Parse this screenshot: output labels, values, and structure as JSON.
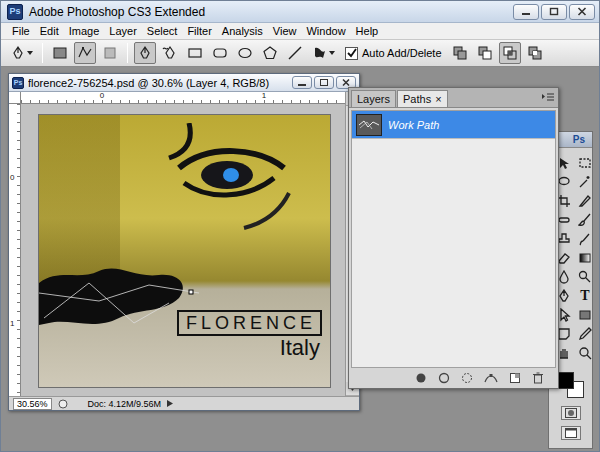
{
  "window": {
    "title": "Adobe Photoshop CS3 Extended",
    "app_icon": "Ps"
  },
  "menu": [
    "File",
    "Edit",
    "Image",
    "Layer",
    "Select",
    "Filter",
    "Analysis",
    "View",
    "Window",
    "Help"
  ],
  "options_bar": {
    "auto_add_delete": {
      "label": "Auto Add/Delete",
      "checked": true
    }
  },
  "document": {
    "title": "florence2-756254.psd @ 30.6% (Layer 4, RGB/8)",
    "ruler_top": [
      "0",
      "1"
    ],
    "ruler_left": [
      "0",
      "1"
    ],
    "canvas_texts": {
      "title": "FLORENCE",
      "subtitle": "Italy"
    },
    "zoom": "30.56%",
    "doc_info": "Doc: 4.12M/9.56M"
  },
  "panel": {
    "close_glyph": "×",
    "tabs": [
      {
        "label": "Layers",
        "selected": false,
        "closable": false
      },
      {
        "label": "Paths",
        "selected": true,
        "closable": true
      }
    ],
    "paths": [
      {
        "name": "Work Path",
        "selected": true
      }
    ]
  },
  "tools": {
    "logo": "Ps",
    "type_tool": "T"
  }
}
